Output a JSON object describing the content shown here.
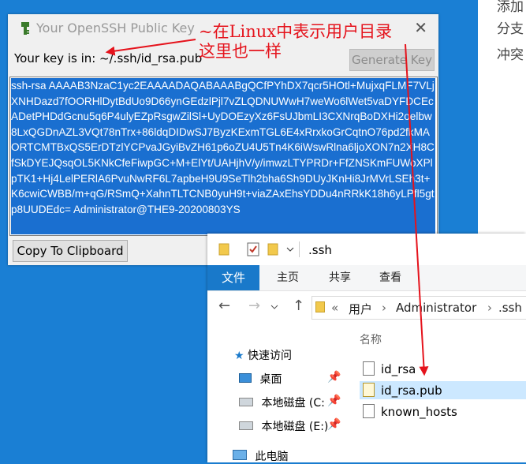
{
  "background_doc": {
    "lines": [
      "添加",
      "分支",
      "冲突"
    ]
  },
  "ssh_dialog": {
    "title": "Your OpenSSH Public Key",
    "close_glyph": "✕",
    "key_location_label": "Your key is in: ~/.ssh/id_rsa.pub",
    "generate_key_label": "Generate Key",
    "public_key": "ssh-rsa AAAAB3NzaC1yc2EAAAADAQABAAABgQCfPYhDX7qcr5HOtl+MujxqFLMF7VLjXNHDazd7fOORHlDytBdUo9D66ynGEdzlPjl7vZLQDNUWwH7weWo6lWet5vaDYFDCEcADetPHDdGcnu5q6P4ulyEZpRsgwZilSl+UyDOEzyXz6FsUJbmLI3CXNrqBoDXHi2oelbw8LxQGDnAZL3VQt78nTrx+86ldqDIDwSJ7ByzKExmTGL6E4xRrxkoGrCqtnO76pd2fkMAORTCMTBxQS5ErDTzlYCPvaJGyiBvZH61p6oZU4U5Tn4K6iWswRlna6ljoXON7n2XH8CfSkDYEJQsqOL5KNkCfeFiwpGC+M+ElYt/UAHjhV/y/imwzLTYPRDr+FfZNSKmFUWoXPlpTK1+Hj4LelPERlA6PvuNwRF6L7apbeH9U9SeTlh2bha6Sh9DUyJKnHi8JrMVrLSEh3t+K6cwiCWBB/m+qG/RSmQ+XahnTLTCNB0yuH9t+viaZAxEhsYDDu4nRRkK18h6yLPfl5gtp8UUDEdc= Administrator@THE9-20200803YS",
    "copy_label": "Copy To Clipboard"
  },
  "annotation": {
    "line1": "~在Linux中表示用户目录",
    "line2": "这里也一样",
    "color": "#e5131c"
  },
  "explorer": {
    "title": ".ssh",
    "ribbon_tabs": [
      "文件",
      "主页",
      "共享",
      "查看"
    ],
    "breadcrumb": [
      "«",
      "用户",
      "›",
      "Administrator",
      "›",
      ".ssh"
    ],
    "column_header": "名称",
    "sidebar": [
      "快速访问",
      "桌面",
      "本地磁盘 (C:",
      "本地磁盘 (E:)",
      "此电脑"
    ],
    "files": [
      {
        "name": "id_rsa",
        "selected": false
      },
      {
        "name": "id_rsa.pub",
        "selected": true
      },
      {
        "name": "known_hosts",
        "selected": false
      }
    ],
    "accent": "#1979ca"
  }
}
